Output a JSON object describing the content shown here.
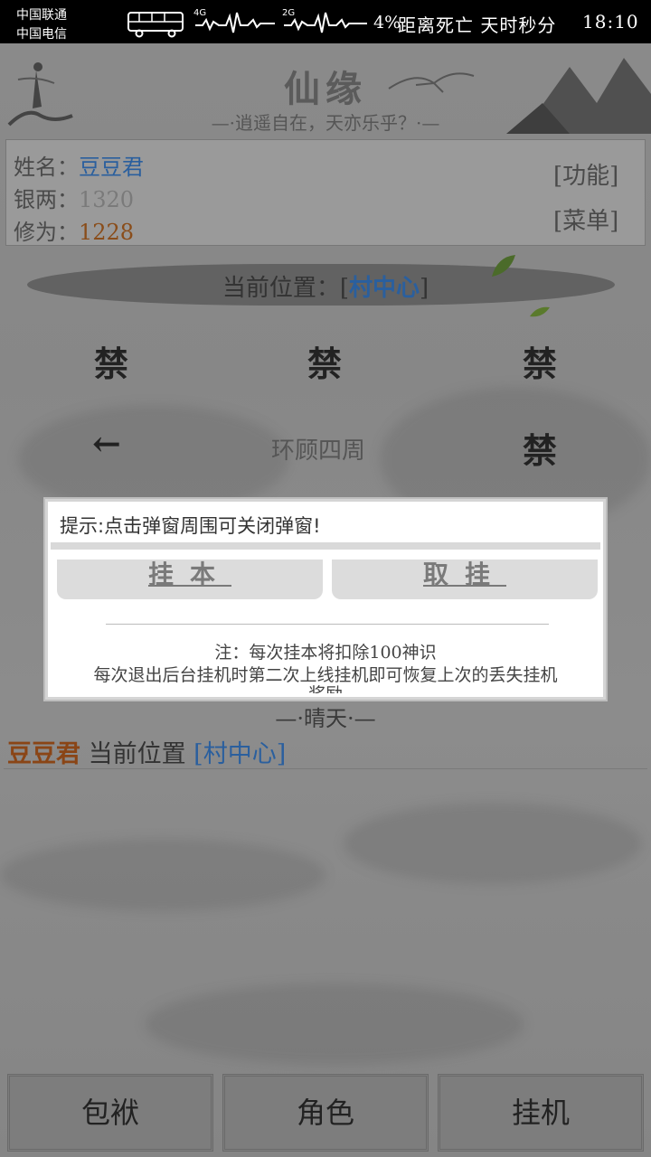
{
  "status_bar": {
    "carrier1": "中国联通",
    "carrier2": "中国电信",
    "network1": "4G",
    "network2": "2G",
    "battery": "4%",
    "countdown": "距离死亡 天时秒分",
    "time": "18:10"
  },
  "header": {
    "title": "仙缘",
    "subtitle": "—·逍遥自在，天亦乐乎？·—"
  },
  "player": {
    "name_label": "姓名：",
    "name": "豆豆君",
    "silver_label": "银两：",
    "silver": "1320",
    "cultivation_label": "修为：",
    "cultivation": "1228"
  },
  "side_buttons": {
    "function": "[功能]",
    "menu": "[菜单]"
  },
  "location": {
    "prefix": "当前位置：",
    "open_bracket": "[",
    "name": "村中心",
    "close_bracket": "]"
  },
  "directions": {
    "north_west": "禁",
    "north": "禁",
    "north_east": "禁",
    "west": "←",
    "look_around": "环顾四周",
    "east": "禁"
  },
  "weather": "—·晴天·—",
  "log": {
    "player": "豆豆君",
    "text": " 当前位置 ",
    "location": "[村中心]"
  },
  "modal": {
    "tip": "提示:点击弹窗周围可关闭弹窗!",
    "button_hang": "挂本",
    "button_cancel": "取挂",
    "note1": "注：每次挂本将扣除100神识",
    "note2": "每次退出后台挂机时第二次上线挂机即可恢复上次的丢失挂机",
    "note3": "奖励"
  },
  "bottom_nav": {
    "bag": "包袱",
    "character": "角色",
    "idle": "挂机"
  }
}
